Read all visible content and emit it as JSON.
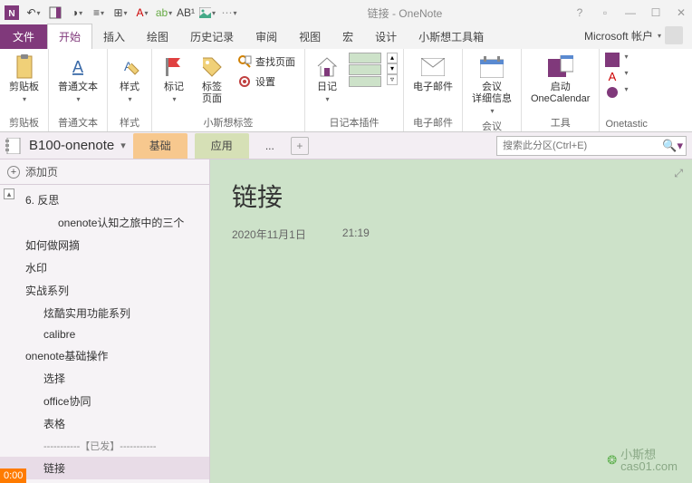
{
  "title": "链接 - OneNote",
  "account": "Microsoft 帐户",
  "tabs": {
    "file": "文件",
    "items": [
      "开始",
      "插入",
      "绘图",
      "历史记录",
      "审阅",
      "视图",
      "宏",
      "设计",
      "小斯想工具箱"
    ],
    "active": 0
  },
  "ribbon": {
    "clipboard": {
      "paste": "剪贴板",
      "label": "剪贴板"
    },
    "text": {
      "plain": "普通文本",
      "label": "普通文本"
    },
    "styles": {
      "btn": "样式",
      "label": "样式"
    },
    "tags": {
      "mark": "标记",
      "tagpage": "标签\n页面",
      "find": "查找页面",
      "settings": "设置",
      "label": "小斯想标签"
    },
    "diary": {
      "btn": "日记",
      "label": "日记本插件"
    },
    "email": {
      "btn": "电子邮件",
      "label": "电子邮件"
    },
    "meeting": {
      "btn": "会议\n详细信息",
      "label": "会议"
    },
    "tools": {
      "btn": "启动\nOneCalendar",
      "label": "工具"
    },
    "onetastic": {
      "label": "Onetastic"
    }
  },
  "notebook": {
    "name": "B100-onenote",
    "sections": [
      "基础",
      "应用"
    ],
    "dots": "...",
    "search_ph": "搜索此分区(Ctrl+E)"
  },
  "pages": {
    "add": "添加页",
    "items": [
      {
        "t": "6. 反思",
        "lv": 0
      },
      {
        "t": "onenote认知之旅中的三个",
        "lv": 2
      },
      {
        "t": "如何做网摘",
        "lv": 0,
        "top": true
      },
      {
        "t": "水印",
        "lv": 0,
        "top": true
      },
      {
        "t": "实战系列",
        "lv": 0,
        "top": true
      },
      {
        "t": "炫酷实用功能系列",
        "lv": 1
      },
      {
        "t": "calibre",
        "lv": 1
      },
      {
        "t": "onenote基础操作",
        "lv": 0,
        "top": true
      },
      {
        "t": "选择",
        "lv": 1
      },
      {
        "t": "office协同",
        "lv": 1
      },
      {
        "t": "表格",
        "lv": 1
      },
      {
        "t": "-----------【已发】-----------",
        "lv": 0,
        "sep": true
      },
      {
        "t": "链接",
        "lv": 1,
        "sel": true
      }
    ]
  },
  "page": {
    "title": "链接",
    "date": "2020年11月1日",
    "time": "21:19"
  },
  "overlay": {
    "time": "0:00",
    "wm_name": "小斯想",
    "wm_url": "cas01.com"
  }
}
